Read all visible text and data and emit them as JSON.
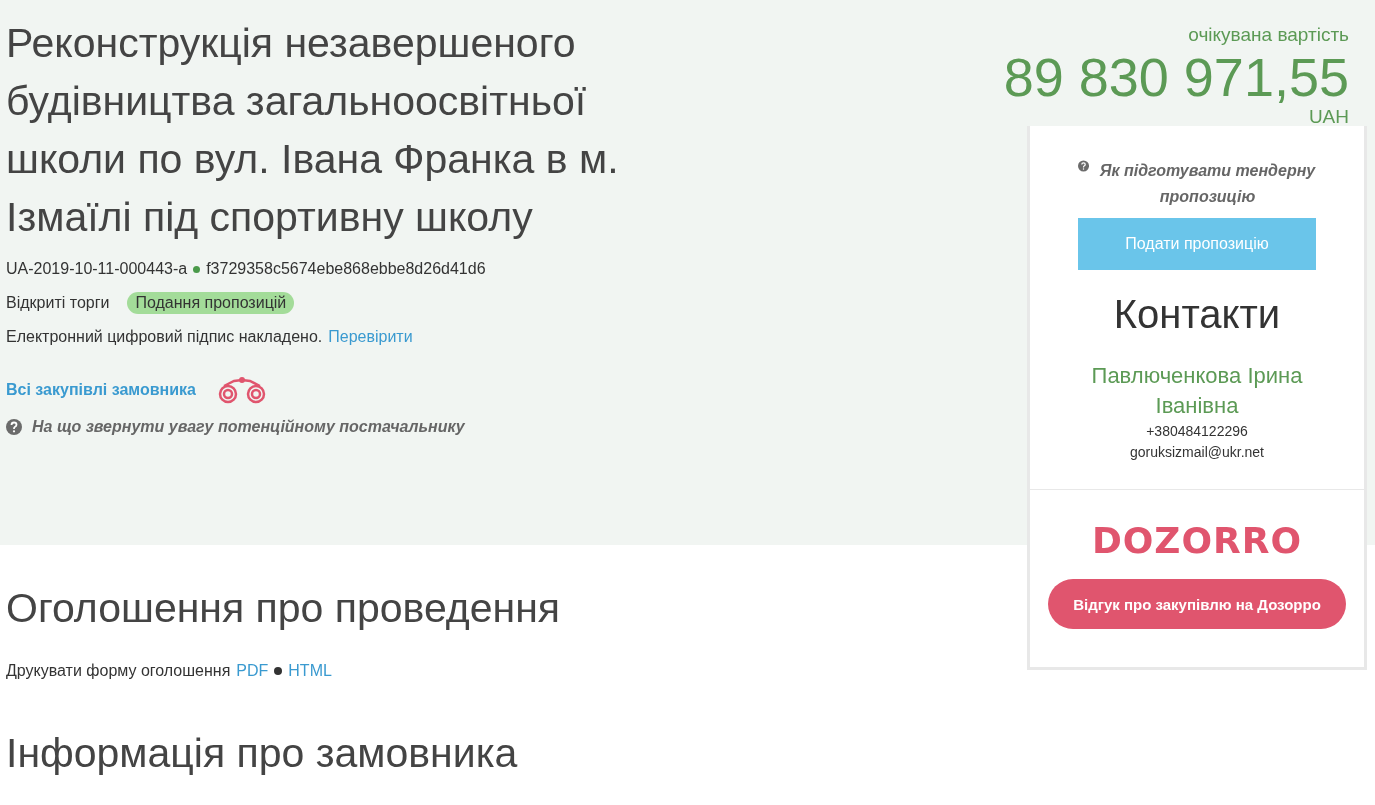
{
  "title": "Реконструкція незавершеного будівництва загальноосвітньої школи по вул. Івана Франка в м. Ізмаїлі під спортивну школу",
  "tender_id": "UA-2019-10-11-000443-a",
  "hash": "f3729358c5674ebe868ebbe8d26d41d6",
  "procedure": "Відкриті торги",
  "status_badge": "Подання пропозицій",
  "signature": {
    "text": "Електронний цифровий підпис накладено.",
    "link": "Перевірити"
  },
  "buyer_link": "Всі закупівлі замовника",
  "supplier_hint": "На що звернути увагу потенційному постачальнику",
  "expected_value": {
    "label": "очікувана вартість",
    "amount": "89 830 971,55",
    "currency": "UAH"
  },
  "sidebar": {
    "hint": "Як підготувати тендерну пропозицію",
    "submit_button": "Подати пропозицію",
    "contacts_title": "Контакти",
    "contact_name": "Павлюченкова Ірина Іванівна",
    "phone": "+380484122296",
    "email": "goruksizmail@ukr.net",
    "logo": "DOZORRO",
    "review_button": "Відгук про закупівлю на Дозорро"
  },
  "announcement": {
    "title": "Оголошення про проведення",
    "print_label": "Друкувати форму оголошення",
    "formats": [
      "PDF",
      "HTML"
    ]
  },
  "section_title": "Інформація про замовника"
}
